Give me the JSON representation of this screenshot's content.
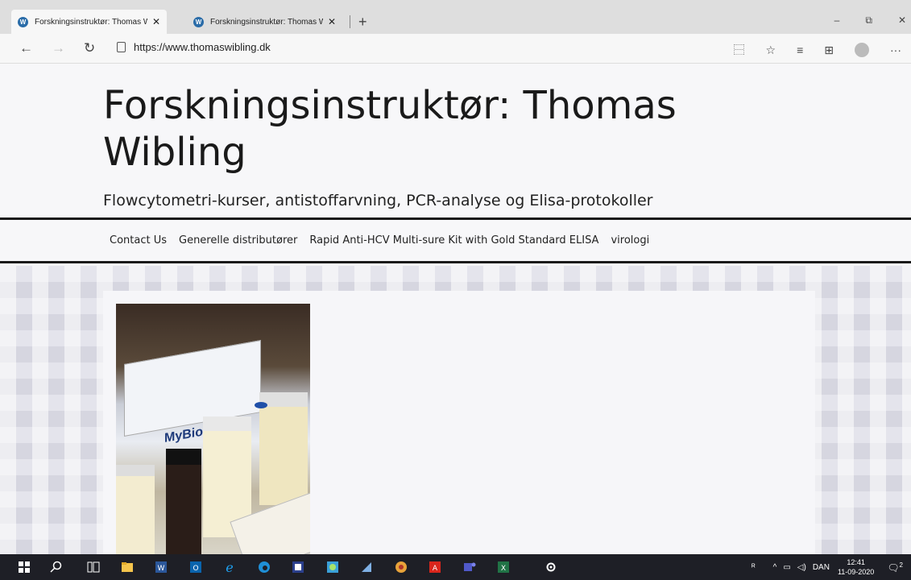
{
  "browser": {
    "tabs": [
      {
        "title": "Forskningsinstruktør: Thomas W",
        "active": true
      },
      {
        "title": "Forskningsinstruktør: Thomas W",
        "active": false
      }
    ],
    "url": "https://www.thomaswibling.dk",
    "window_controls": {
      "minimize": "–",
      "restore": "⧉",
      "close": "✕"
    }
  },
  "site": {
    "title": "Forskningsinstruktør: Thomas Wibling",
    "tagline": "Flowcytometri-kurser, antistoffarvning, PCR-analyse og Elisa-protokoller"
  },
  "menu": {
    "items": [
      "Contact Us",
      "Generelle distributører",
      "Rapid Anti-HCV Multi-sure Kit with Gold Standard ELISA",
      "virologi"
    ]
  },
  "photo": {
    "brand": "MyBioSource"
  },
  "taskbar": {
    "language": "DAN",
    "time": "12:41",
    "date": "11-09-2020",
    "notifications": "2"
  },
  "colors": {
    "header_border": "#1a1a1a",
    "taskbar_bg": "#1e1f26",
    "tab_bar": "#dedede"
  }
}
